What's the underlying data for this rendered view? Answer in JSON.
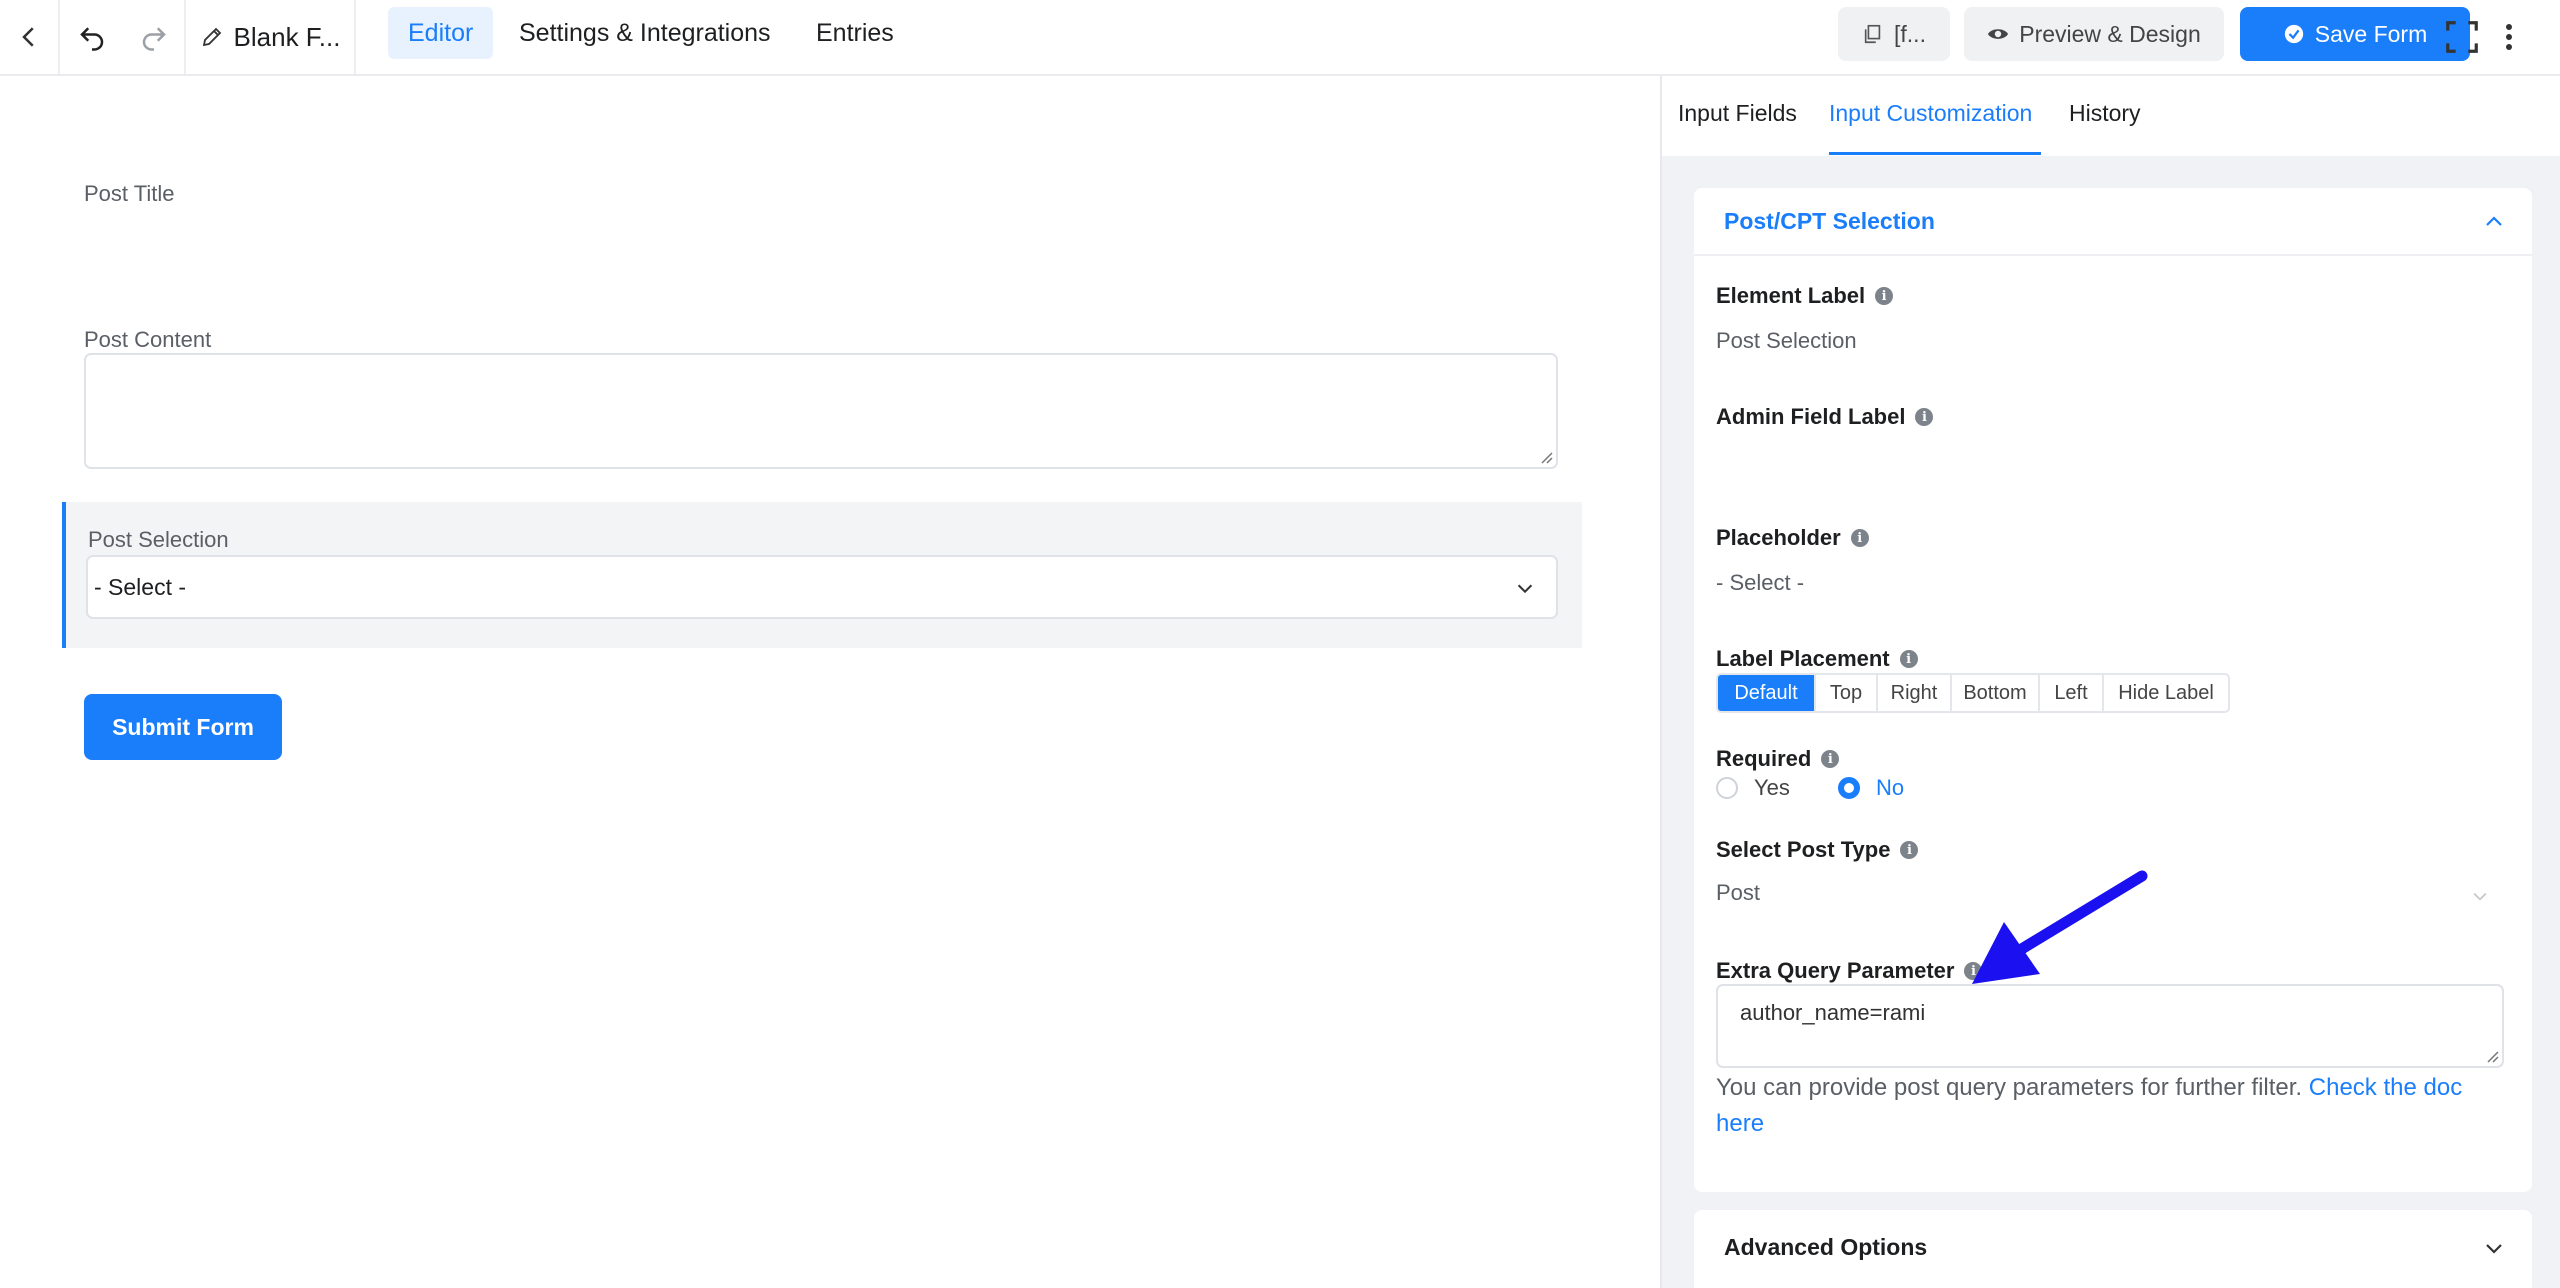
{
  "topbar": {
    "form_name": "Blank F...",
    "tabs": [
      {
        "label": "Editor",
        "active": true
      },
      {
        "label": "Settings & Integrations",
        "active": false
      },
      {
        "label": "Entries",
        "active": false
      }
    ],
    "shortcode_label": "[f...",
    "preview_label": "Preview & Design",
    "save_label": "Save Form"
  },
  "form": {
    "post_title_label": "Post Title",
    "post_content_label": "Post Content",
    "post_selection_label": "Post Selection",
    "post_selection_value": "- Select -",
    "submit_label": "Submit Form"
  },
  "panel": {
    "tabs": [
      {
        "label": "Input Fields",
        "active": false
      },
      {
        "label": "Input Customization",
        "active": true
      },
      {
        "label": "History",
        "active": false
      }
    ],
    "section_title": "Post/CPT Selection",
    "element_label": {
      "label": "Element Label",
      "value": "Post Selection"
    },
    "admin_field_label": {
      "label": "Admin Field Label",
      "value": ""
    },
    "placeholder": {
      "label": "Placeholder",
      "value": "- Select -"
    },
    "label_placement": {
      "label": "Label Placement",
      "options": [
        "Default",
        "Top",
        "Right",
        "Bottom",
        "Left",
        "Hide Label"
      ],
      "selected": "Default"
    },
    "required": {
      "label": "Required",
      "options": [
        "Yes",
        "No"
      ],
      "selected": "No"
    },
    "post_type": {
      "label": "Select Post Type",
      "value": "Post"
    },
    "extra_query": {
      "label": "Extra Query Parameter",
      "value": "author_name=rami",
      "help_text": "You can provide post query parameters for further filter.",
      "help_link": "Check the doc here"
    },
    "advanced_title": "Advanced Options"
  },
  "colors": {
    "accent": "#1a7efb",
    "annotation_arrow": "#1a10f0"
  }
}
